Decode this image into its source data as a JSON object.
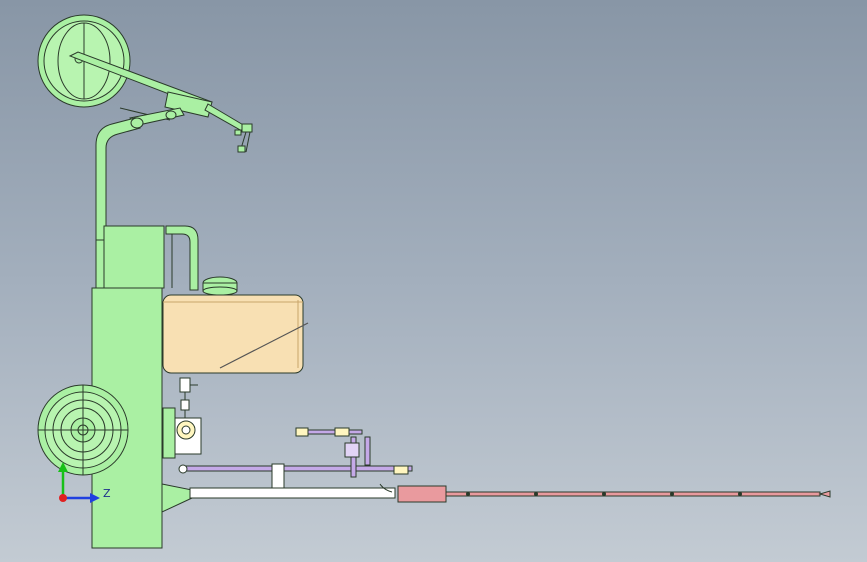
{
  "triad": {
    "z_label": "Z"
  },
  "colors": {
    "background_top": "#8896a6",
    "background_bottom": "#c3cbd3",
    "frame_green": "#aaf0a3",
    "tank_tan": "#f8e0b3",
    "lance_pink": "#e99a9e",
    "pipe_purple": "#c5a9e8",
    "axis_x": "#e02020",
    "axis_y": "#18c018",
    "axis_z": "#2040e0"
  }
}
